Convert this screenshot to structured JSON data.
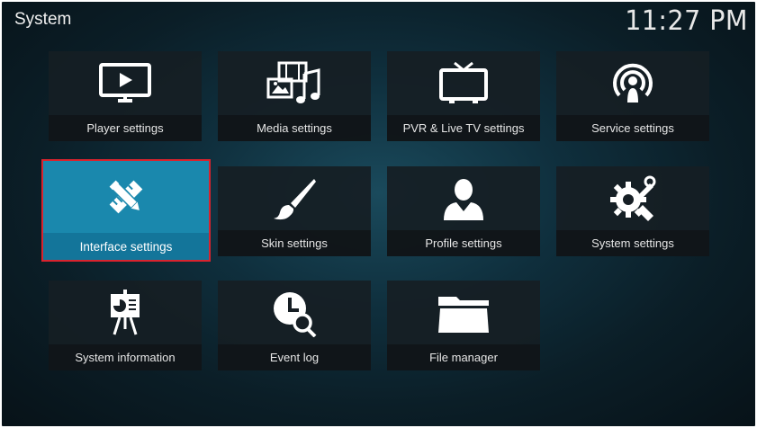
{
  "header": {
    "title": "System",
    "clock": "11:27 PM"
  },
  "tiles": [
    {
      "label": "Player settings",
      "icon": "player-icon"
    },
    {
      "label": "Media settings",
      "icon": "media-icon"
    },
    {
      "label": "PVR & Live TV settings",
      "icon": "tv-icon"
    },
    {
      "label": "Service settings",
      "icon": "service-icon"
    },
    {
      "label": "Interface settings",
      "icon": "interface-icon"
    },
    {
      "label": "Skin settings",
      "icon": "brush-icon"
    },
    {
      "label": "Profile settings",
      "icon": "profile-icon"
    },
    {
      "label": "System settings",
      "icon": "gears-icon"
    },
    {
      "label": "System information",
      "icon": "presentation-icon"
    },
    {
      "label": "Event log",
      "icon": "clock-search-icon"
    },
    {
      "label": "File manager",
      "icon": "folder-icon"
    }
  ],
  "colors": {
    "active_tile": "#1a88ad",
    "focus_outline": "#d9232e"
  }
}
